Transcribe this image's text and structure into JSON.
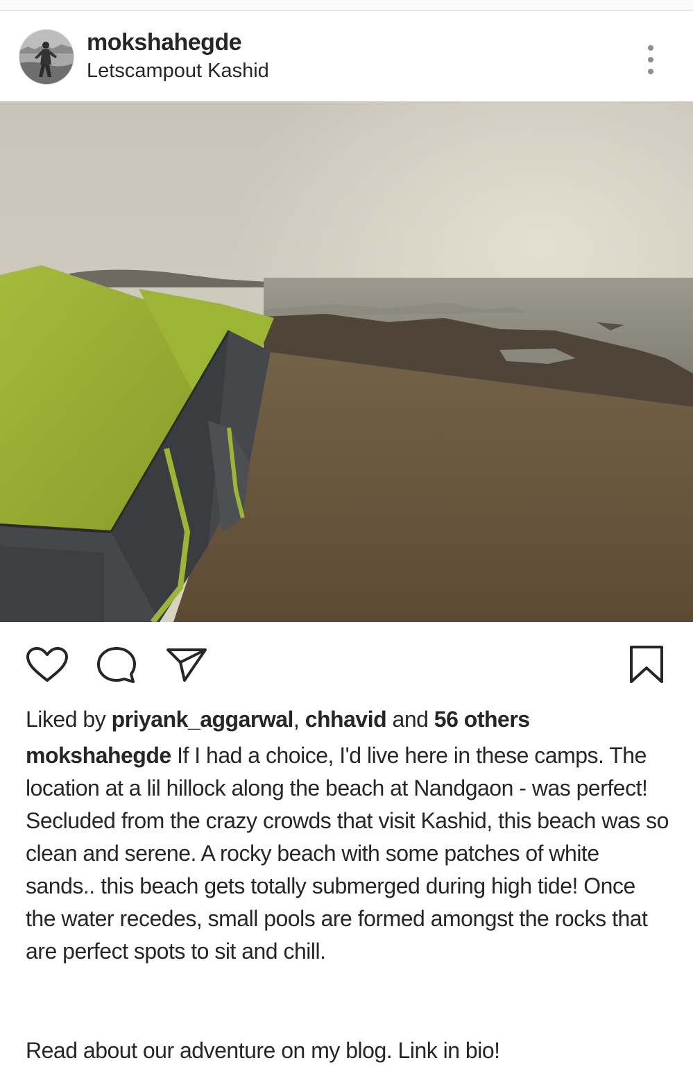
{
  "post": {
    "author": {
      "username": "mokshahegde",
      "location": "Letscampout Kashid",
      "avatar": "profile-photo"
    },
    "menu_icon": "more-options-icon",
    "photo": {
      "description_icon": "tents-on-hillock-by-beach-photo",
      "colors": {
        "sky": "#cfc9bb",
        "sea": "#8e8c80",
        "ground": "#6b5a3f",
        "tent_fly": "#9bb033",
        "tent_body": "#45474a"
      }
    },
    "actions": {
      "like_icon": "heart-icon",
      "comment_icon": "comment-icon",
      "share_icon": "send-icon",
      "save_icon": "bookmark-icon"
    },
    "likes": {
      "prefix": "Liked by",
      "user1": "priyank_aggarwal",
      "separator": ",",
      "user2": "chhavid",
      "conjunction": "and",
      "others": "56 others"
    },
    "caption": {
      "username": "mokshahegde",
      "text": "If I had a choice, I'd live here in these camps. The location at a lil hillock along the beach at Nandgaon - was perfect! Secluded from the crazy crowds that visit Kashid, this beach was so clean and serene. A rocky beach with some patches of white sands.. this beach gets totally submerged during high tide! Once the water recedes, small pools are formed amongst the rocks that are perfect spots to sit and chill.",
      "blog_note": "Read about our adventure on my blog. Link in bio!"
    }
  }
}
